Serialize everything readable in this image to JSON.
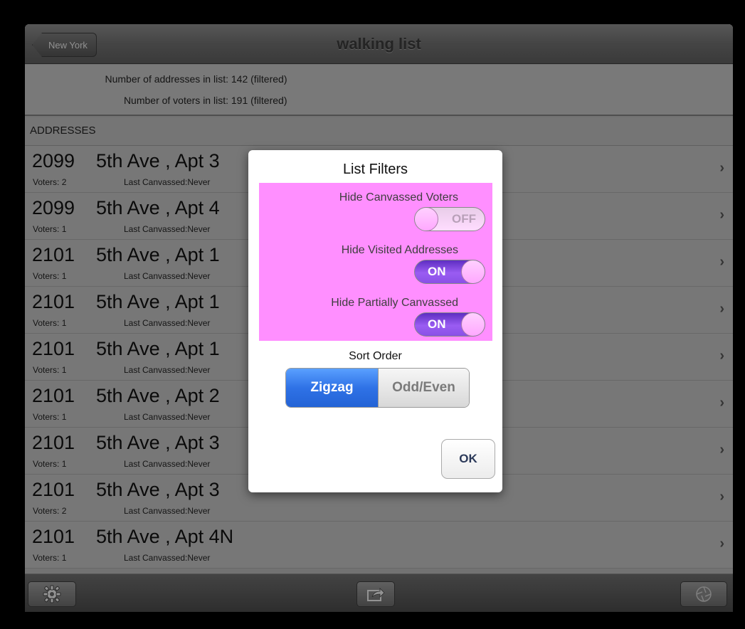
{
  "nav": {
    "back_label": "New York",
    "title": "walking list"
  },
  "summary": {
    "addresses_label": "Number of addresses in list:",
    "addresses_value": "142 (filtered)",
    "voters_label": "Number of voters in list:",
    "voters_value": "191 (filtered)"
  },
  "section_header": "ADDRESSES",
  "rows": [
    {
      "num": "2099",
      "street": "5th Ave , Apt 3",
      "voters": "Voters: 2",
      "last": "Last Canvassed:Never"
    },
    {
      "num": "2099",
      "street": "5th Ave , Apt 4",
      "voters": "Voters: 1",
      "last": "Last Canvassed:Never"
    },
    {
      "num": "2101",
      "street": "5th Ave , Apt 1",
      "voters": "Voters: 1",
      "last": "Last Canvassed:Never"
    },
    {
      "num": "2101",
      "street": "5th Ave , Apt 1",
      "voters": "Voters: 1",
      "last": "Last Canvassed:Never"
    },
    {
      "num": "2101",
      "street": "5th Ave , Apt 1",
      "voters": "Voters: 1",
      "last": "Last Canvassed:Never"
    },
    {
      "num": "2101",
      "street": "5th Ave , Apt 2",
      "voters": "Voters: 1",
      "last": "Last Canvassed:Never"
    },
    {
      "num": "2101",
      "street": "5th Ave , Apt 3",
      "voters": "Voters: 1",
      "last": "Last Canvassed:Never"
    },
    {
      "num": "2101",
      "street": "5th Ave , Apt 3",
      "voters": "Voters: 2",
      "last": "Last Canvassed:Never"
    },
    {
      "num": "2101",
      "street": "5th Ave , Apt 4N",
      "voters": "Voters: 1",
      "last": "Last Canvassed:Never"
    }
  ],
  "row_chevron": "›",
  "dialog": {
    "title": "List Filters",
    "filters": [
      {
        "label": "Hide Canvassed Voters",
        "state": "OFF"
      },
      {
        "label": "Hide Visited Addresses",
        "state": "ON"
      },
      {
        "label": "Hide Partially Canvassed",
        "state": "ON"
      }
    ],
    "sort_label": "Sort Order",
    "sort_options": [
      "Zigzag",
      "Odd/Even"
    ],
    "sort_selected": "Zigzag",
    "ok_label": "OK"
  },
  "toolbar": {
    "icons": [
      "gear-icon",
      "share-icon",
      "aperture-icon"
    ]
  },
  "colors": {
    "filters_bg": "#ff8fff",
    "toggle_on": "#9a5cf2",
    "segment_selected": "#2f72e6"
  }
}
